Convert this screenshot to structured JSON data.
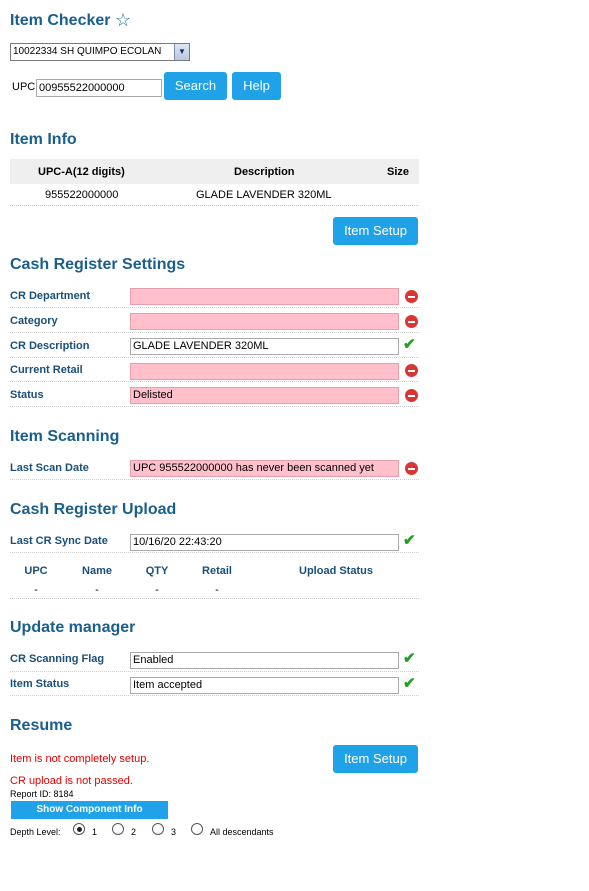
{
  "header": {
    "title": "Item Checker",
    "store_select_value": "10022334 SH QUIMPO ECOLAN",
    "upc_label": "UPC",
    "upc_value": "00955522000000",
    "search_label": "Search",
    "help_label": "Help"
  },
  "item_info": {
    "title": "Item Info",
    "columns": [
      "UPC-A(12 digits)",
      "Description",
      "Size"
    ],
    "rows": [
      [
        "955522000000",
        "GLADE LAVENDER 320ML",
        ""
      ]
    ],
    "setup_button": "Item Setup"
  },
  "cash_register_settings": {
    "title": "Cash Register Settings",
    "fields": [
      {
        "label": "CR Department",
        "value": "",
        "status": "error"
      },
      {
        "label": "Category",
        "value": "",
        "status": "error"
      },
      {
        "label": "CR Description",
        "value": "GLADE LAVENDER 320ML",
        "status": "ok"
      },
      {
        "label": "Current Retail",
        "value": "",
        "status": "error"
      },
      {
        "label": "Status",
        "value": "Delisted",
        "status": "error"
      }
    ]
  },
  "item_scanning": {
    "title": "Item Scanning",
    "fields": [
      {
        "label": "Last Scan Date",
        "value": "UPC 955522000000 has never been scanned yet",
        "status": "error"
      }
    ]
  },
  "cash_register_upload": {
    "title": "Cash Register Upload",
    "fields": [
      {
        "label": "Last CR Sync Date",
        "value": "10/16/20 22:43:20",
        "status": "ok"
      }
    ],
    "columns": [
      "UPC",
      "Name",
      "QTY",
      "Retail",
      "Upload Status"
    ],
    "rows": [
      [
        "-",
        "-",
        "-",
        "-",
        ""
      ]
    ]
  },
  "update_manager": {
    "title": "Update manager",
    "fields": [
      {
        "label": "CR Scanning Flag",
        "value": "Enabled",
        "status": "ok"
      },
      {
        "label": "Item Status",
        "value": "Item accepted",
        "status": "ok"
      }
    ]
  },
  "resume": {
    "title": "Resume",
    "messages": [
      "Item is not completely setup.",
      "CR upload is not passed."
    ],
    "setup_button": "Item Setup",
    "report_id": "Report ID: 8184",
    "component_button": "Show Component Info",
    "depth_label": "Depth Level:",
    "depth_options": [
      "1",
      "2",
      "3",
      "All descendants"
    ],
    "depth_selected": "1"
  },
  "colors": {
    "heading": "#1a5f8c",
    "button": "#1fa2e8",
    "error_field": "#ffc0cb",
    "error_icon": "#d93636",
    "ok_icon": "#1fa31f",
    "error_text": "#e00000"
  },
  "icons": {
    "favorite": "star-outline-icon",
    "error": "no-entry-icon",
    "ok": "checkmark-icon"
  }
}
